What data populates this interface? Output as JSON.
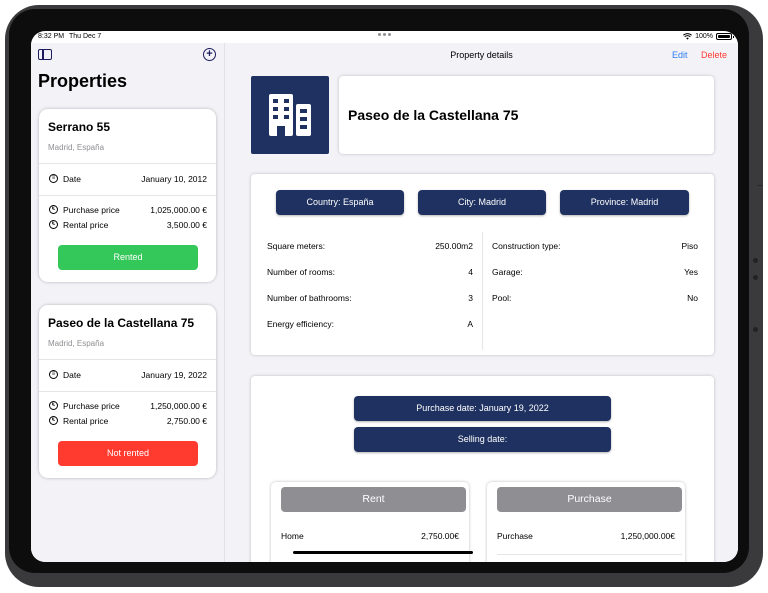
{
  "status_bar": {
    "time": "8:32 PM",
    "date": "Thu Dec 7",
    "battery": "100%"
  },
  "sidebar": {
    "title": "Properties",
    "properties": [
      {
        "name": "Serrano 55",
        "location": "Madrid, España",
        "date_label": "Date",
        "date": "January 10, 2012",
        "purchase_label": "Purchase price",
        "purchase_price": "1,025,000.00 €",
        "rental_label": "Rental price",
        "rental_price": "3,500.00 €",
        "status": "Rented",
        "status_color": "#34c759"
      },
      {
        "name": "Paseo de la Castellana 75",
        "location": "Madrid, España",
        "date_label": "Date",
        "date": "January 19, 2022",
        "purchase_label": "Purchase price",
        "purchase_price": "1,250,000.00 €",
        "rental_label": "Rental price",
        "rental_price": "2,750.00 €",
        "status": "Not rented",
        "status_color": "#ff3b30"
      }
    ]
  },
  "detail": {
    "nav_title": "Property details",
    "edit_label": "Edit",
    "delete_label": "Delete",
    "title": "Paseo de la Castellana 75",
    "tags": [
      "Country:   España",
      "City:   Madrid",
      "Province:   Madrid"
    ],
    "specs_left": [
      {
        "label": "Square meters:",
        "value": "250.00m2"
      },
      {
        "label": "Number of rooms:",
        "value": "4"
      },
      {
        "label": "Number of bathrooms:",
        "value": "3"
      },
      {
        "label": "Energy efficiency:",
        "value": "A"
      }
    ],
    "specs_right": [
      {
        "label": "Construction type:",
        "value": "Piso"
      },
      {
        "label": "Garage:",
        "value": "Yes"
      },
      {
        "label": "Pool:",
        "value": "No"
      }
    ],
    "purchase_date": "Purchase date: January 19, 2022",
    "selling_date": "Selling date:",
    "rent_card": {
      "title": "Rent",
      "label": "Home",
      "value": "2,750.00€"
    },
    "purchase_card": {
      "title": "Purchase",
      "label": "Purchase",
      "value": "1,250,000.00€"
    }
  },
  "colors": {
    "navy": "#1e3160",
    "accent": "#2f7bf5",
    "destructive": "#ff3b30",
    "success": "#34c759"
  },
  "icons": [
    "sidebar-toggle-icon",
    "add-circle-icon",
    "calendar-icon",
    "euro-icon",
    "building-icon",
    "wifi-icon",
    "battery-icon"
  ]
}
